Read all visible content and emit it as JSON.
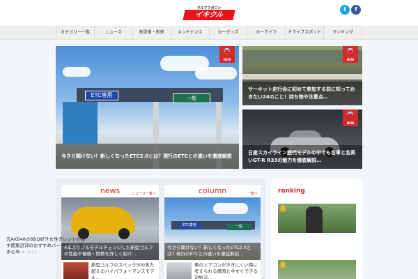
{
  "header": {
    "logo_tagline": "クルママガジン",
    "logo_text": "イキクル",
    "twitter_glyph": "t",
    "facebook_glyph": "f"
  },
  "nav": {
    "items": [
      "カテゴリー一覧",
      "ニュース",
      "新型車・新車",
      "メンテナンス",
      "カーグッズ",
      "カーライフ",
      "ドライブスポット",
      "ランキング"
    ]
  },
  "hero": {
    "big": {
      "sign_left": "ETC専用",
      "sign_right": "一般",
      "title": "今さら聞けない！新しくなったETC2.0とは？現行のETCとの違いを徹底解説",
      "badge": "NEW"
    },
    "top_right": {
      "title": "サーキット走行会に初めて参加する前に知っておきたい24のこと！持ち物や注意点…",
      "badge": "NEW"
    },
    "bottom_right": {
      "title": "日産スカイライン歴代モデルの中でも名車と名高いGT-R R33の魅力を徹底解説…",
      "badge": "NEW"
    }
  },
  "columns": {
    "news": {
      "title": "news",
      "more": "ニュース一覧へ",
      "caption": "4年ぶりフルモデルチェンジした新型ゴルフの性能や価格・燃費を詳しく紹介…",
      "mini_text": "新型ゴルフのスペック500馬力超えのハイパフォーマンスモデル…"
    },
    "column": {
      "title": "column",
      "more": "一覧へ",
      "sign_left": "ETC専用",
      "sign_right": "一般",
      "caption": "今さら聞けない！新しくなったETC2.0とは？現行のETCとの違いを徹底解説…",
      "mini_text": "車のエアコンがききにくい時に考えられる原因と今すぐできる対処法…"
    }
  },
  "ranking": {
    "title": "ranking",
    "rank1": "1",
    "rank2": "2",
    "text": "元AKB48のBBQ好き女性タレントが推す関東近郊のおすすめバーベキュー場まとめ",
    "date": "2017.8.9 カーライフ"
  },
  "colors": {
    "accent": "#d32b2b",
    "logo_red": "#e8141c",
    "twitter": "#1da1f2",
    "facebook": "#3b5998"
  }
}
